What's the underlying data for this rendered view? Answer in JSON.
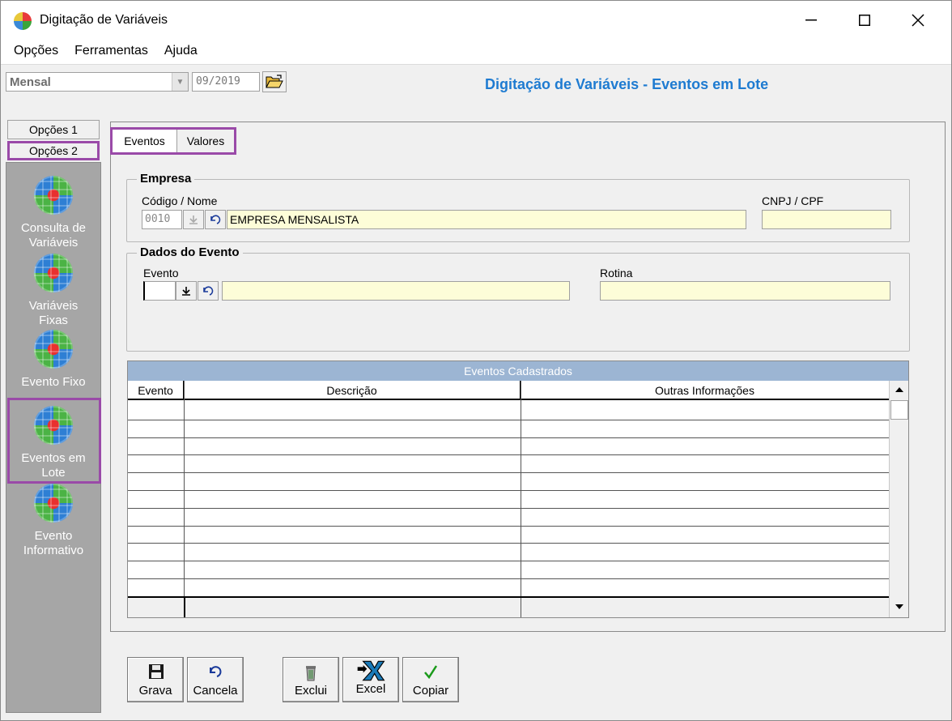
{
  "window": {
    "title": "Digitação de Variáveis",
    "minimize": "—",
    "maximize": "☐",
    "close": "✕"
  },
  "menu": [
    "Opções",
    "Ferramentas",
    "Ajuda"
  ],
  "toolbar": {
    "period": "Mensal",
    "date": "09/2019",
    "heading": "Digitação de Variáveis - Eventos em Lote"
  },
  "side_tabs": [
    "Opções 1",
    "Opções 2"
  ],
  "sidebar": {
    "items": [
      {
        "label": "Consulta de Variáveis"
      },
      {
        "label": "Variáveis Fixas"
      },
      {
        "label": "Evento Fixo"
      },
      {
        "label": "Eventos em Lote"
      },
      {
        "label": "Evento Informativo"
      }
    ]
  },
  "tabs": [
    "Eventos",
    "Valores"
  ],
  "empresa": {
    "title": "Empresa",
    "code_label": "Código / Nome",
    "code": "0010",
    "name": "EMPRESA MENSALISTA",
    "cnpj_label": "CNPJ / CPF",
    "cnpj": ""
  },
  "evento": {
    "title": "Dados do Evento",
    "evento_label": "Evento",
    "evento_code": "",
    "evento_name": "",
    "rotina_label": "Rotina",
    "rotina": ""
  },
  "grid": {
    "title": "Eventos Cadastrados",
    "columns": [
      "Evento",
      "Descrição",
      "Outras Informações"
    ]
  },
  "buttons": [
    {
      "label": "Grava"
    },
    {
      "label": "Cancela"
    },
    {
      "label": "Exclui"
    },
    {
      "label": "Excel"
    },
    {
      "label": "Copiar"
    }
  ],
  "colors": {
    "accent": "#1e7bd1",
    "highlight": "#9a4aa8",
    "field_bg": "#fdfdd8",
    "grid_header": "#9cb5d3"
  }
}
